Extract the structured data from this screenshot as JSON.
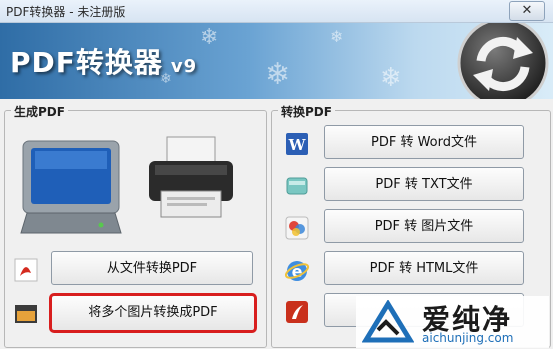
{
  "window": {
    "title": "PDF转换器 - 未注册版",
    "close_glyph": "✕"
  },
  "banner": {
    "title": "PDF转换器",
    "version": "v9"
  },
  "left_group": {
    "label": "生成PDF",
    "buttons": [
      {
        "label": "从文件转换PDF",
        "icon": "pdf-file-icon"
      },
      {
        "label": "将多个图片转换成PDF",
        "icon": "image-folder-icon",
        "highlighted": true
      }
    ]
  },
  "right_group": {
    "label": "转换PDF",
    "buttons": [
      {
        "label": "PDF 转 Word文件",
        "icon": "word-icon"
      },
      {
        "label": "PDF 转 TXT文件",
        "icon": "txt-icon"
      },
      {
        "label": "PDF 转 图片文件",
        "icon": "image-icon"
      },
      {
        "label": "PDF 转 HTML文件",
        "icon": "ie-icon"
      },
      {
        "label": "",
        "icon": "flash-icon"
      }
    ]
  },
  "watermark": {
    "text": "爱纯净",
    "url": "aichunjing.com"
  },
  "colors": {
    "highlight": "#d81e1e",
    "accent_blue": "#2f6da6"
  }
}
